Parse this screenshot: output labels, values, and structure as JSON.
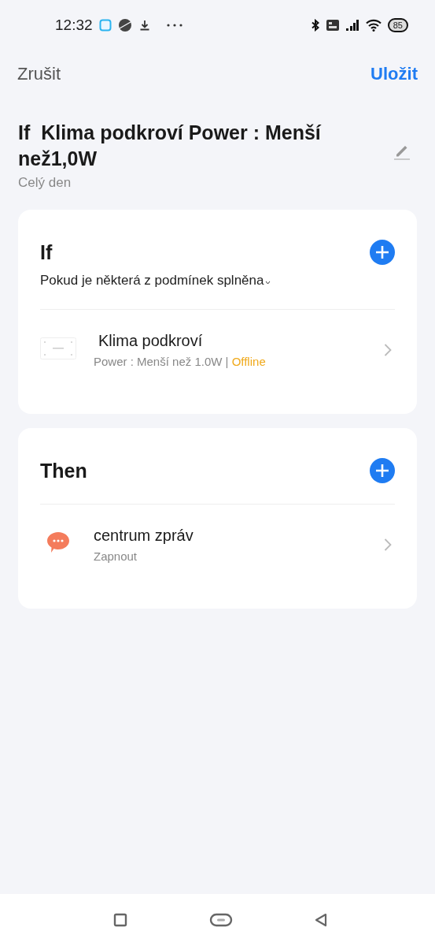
{
  "status_bar": {
    "time": "12:32",
    "battery": "85"
  },
  "header": {
    "cancel": "Zrušit",
    "save": "Uložit"
  },
  "scene": {
    "title": "If  Klima podkroví Power : Menší než1,0W",
    "schedule": "Celý den"
  },
  "sections": [
    {
      "title": "If",
      "mode": "Pokud je některá z podmínek splněna",
      "items": [
        {
          "kind": "device",
          "name": "Klima podkroví",
          "detail": "Power : Menší než 1.0W | ",
          "status": "Offline",
          "color": "#f0a91b"
        }
      ]
    },
    {
      "title": "Then",
      "items": [
        {
          "kind": "message",
          "name": "centrum zpráv",
          "detail": "Zapnout"
        }
      ]
    }
  ]
}
